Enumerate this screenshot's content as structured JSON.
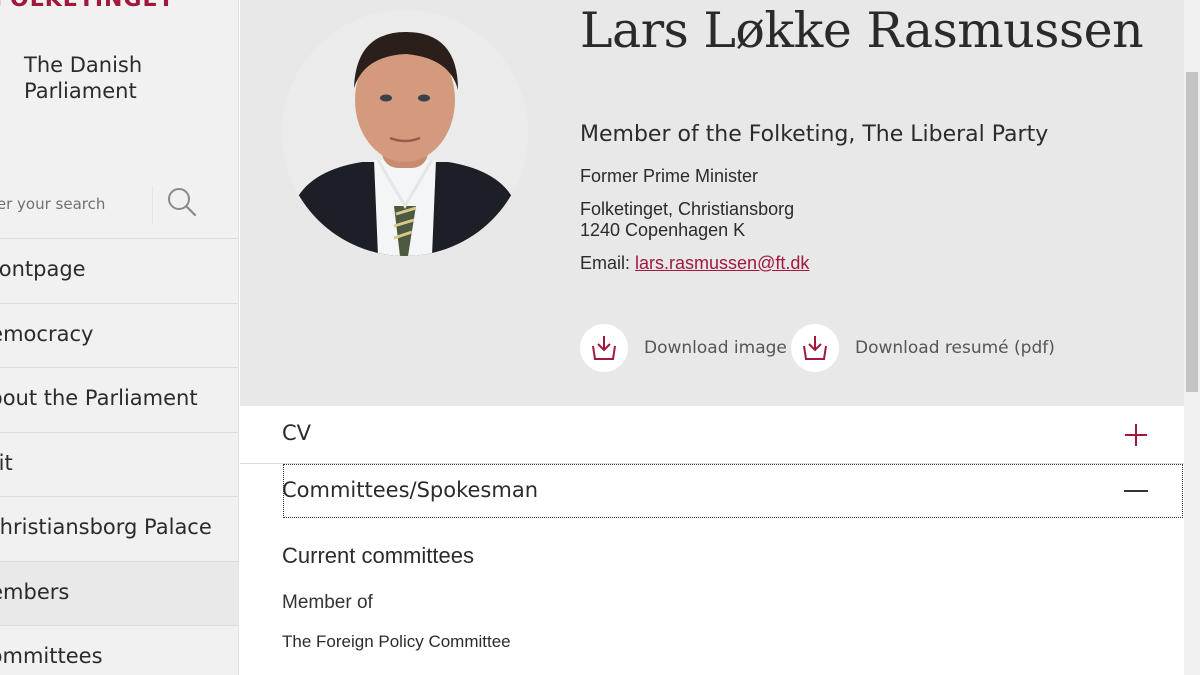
{
  "sidebar": {
    "logo_text": "FOLKETINGET",
    "site_name": "The Danish Parliament",
    "search": {
      "placeholder": "Enter your search"
    },
    "nav": [
      {
        "label": "Frontpage"
      },
      {
        "label": "Democracy"
      },
      {
        "label": "About the Parliament"
      },
      {
        "label": "Visit"
      },
      {
        "label": "Christiansborg Palace"
      },
      {
        "label": "Members",
        "active": true
      },
      {
        "label": "Committees"
      }
    ]
  },
  "profile": {
    "name": "Lars Løkke Rasmussen",
    "role": "Member of the Folketing, The Liberal Party",
    "title": "Former Prime Minister",
    "address_line1": "Folketinget, Christiansborg",
    "address_line2": "1240 Copenhagen K",
    "email_label": "Email:",
    "email": "lars.rasmussen@ft.dk",
    "download_image": "Download image",
    "download_resume": "Download resumé (pdf)"
  },
  "accordions": {
    "cv": {
      "label": "CV",
      "expanded": false
    },
    "committees": {
      "label": "Committees/Spokesman",
      "expanded": true
    }
  },
  "committees": {
    "heading": "Current committees",
    "member_of_label": "Member of",
    "items": [
      "The Foreign Policy Committee"
    ]
  },
  "colors": {
    "accent": "#a1183d",
    "header_bg": "#e8e8e8",
    "sidebar_bg": "#f1f1f1"
  },
  "icons": [
    "search-icon",
    "download-icon",
    "plus-icon",
    "minus-icon"
  ]
}
